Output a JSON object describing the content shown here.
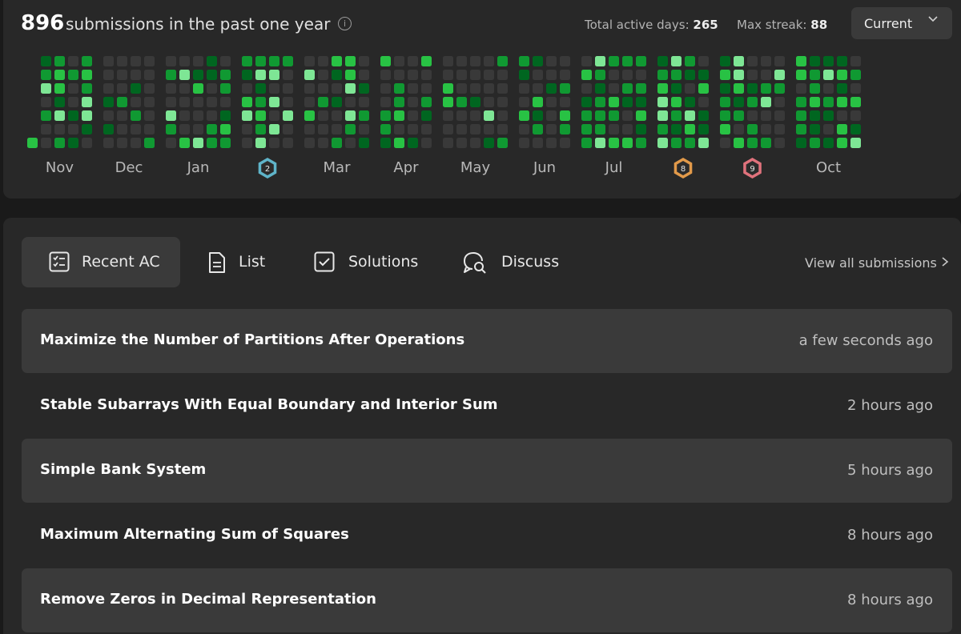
{
  "summary": {
    "count": "896",
    "count_label": "submissions in the past one year",
    "active_days_label": "Total active days:",
    "active_days_value": "265",
    "max_streak_label": "Max streak:",
    "max_streak_value": "88",
    "range_dropdown": "Current"
  },
  "heatmap": {
    "months": [
      "Nov",
      "Dec",
      "Jan",
      "Feb",
      "Mar",
      "Apr",
      "May",
      "Jun",
      "Jul",
      "Aug",
      "Sep",
      "Oct"
    ],
    "month_labels_shown": [
      "Nov",
      "Dec",
      "Jan",
      "",
      "Mar",
      "Apr",
      "May",
      "Jun",
      "Jul",
      "",
      "",
      "Oct"
    ],
    "badges": [
      {
        "month": "Feb",
        "text": "2",
        "color": "#5fb4c9",
        "name": "february-badge-icon"
      },
      {
        "month": "Aug",
        "text": "8",
        "color": "#e29a4a",
        "name": "august-badge-icon"
      },
      {
        "month": "Sep",
        "text": "9",
        "color": "#e0727c",
        "name": "september-badge-icon"
      }
    ],
    "colors": {
      "empty": "#393939",
      "level1": "#006620",
      "level2": "#109932",
      "level3": "#28c244",
      "level4": "#7ee695"
    }
  },
  "tabs": [
    {
      "label": "Recent AC",
      "icon": "checklist-icon",
      "active": true
    },
    {
      "label": "List",
      "icon": "document-icon",
      "active": false
    },
    {
      "label": "Solutions",
      "icon": "checkbox-icon",
      "active": false
    },
    {
      "label": "Discuss",
      "icon": "discussion-icon",
      "active": false
    }
  ],
  "view_all": "View all submissions",
  "submissions": [
    {
      "title": "Maximize the Number of Partitions After Operations",
      "time": "a few seconds ago"
    },
    {
      "title": "Stable Subarrays With Equal Boundary and Interior Sum",
      "time": "2 hours ago"
    },
    {
      "title": "Simple Bank System",
      "time": "5 hours ago"
    },
    {
      "title": "Maximum Alternating Sum of Squares",
      "time": "8 hours ago"
    },
    {
      "title": "Remove Zeros in Decimal Representation",
      "time": "8 hours ago"
    }
  ]
}
